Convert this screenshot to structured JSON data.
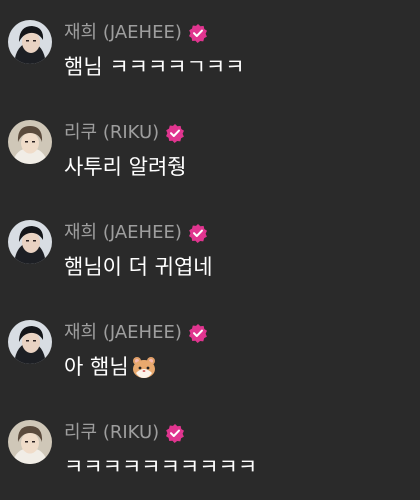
{
  "messages": [
    {
      "author": "재희 (JAEHEE)",
      "text": "햄님 ㅋㅋㅋㅋㄱㅋㅋ",
      "avatar": "jaehee-avatar",
      "verified": true
    },
    {
      "author": "리쿠 (RIKU)",
      "text": "사투리 알려줭",
      "avatar": "riku-avatar",
      "verified": true
    },
    {
      "author": "재희 (JAEHEE)",
      "text": "햄님이 더 귀엽네",
      "avatar": "jaehee-avatar",
      "verified": true
    },
    {
      "author": "재희 (JAEHEE)",
      "text": "아 햄님",
      "emoji": "hamster-emoji",
      "avatar": "jaehee-avatar",
      "verified": true
    },
    {
      "author": "리쿠 (RIKU)",
      "text": "ㅋㅋㅋㅋㅋㅋㅋㅋㅋㅋ",
      "avatar": "riku-avatar",
      "verified": true
    }
  ],
  "colors": {
    "background": "#2a2a2a",
    "author": "#9e9e9e",
    "text": "#ffffff",
    "verified_badge": "#e0358f"
  }
}
